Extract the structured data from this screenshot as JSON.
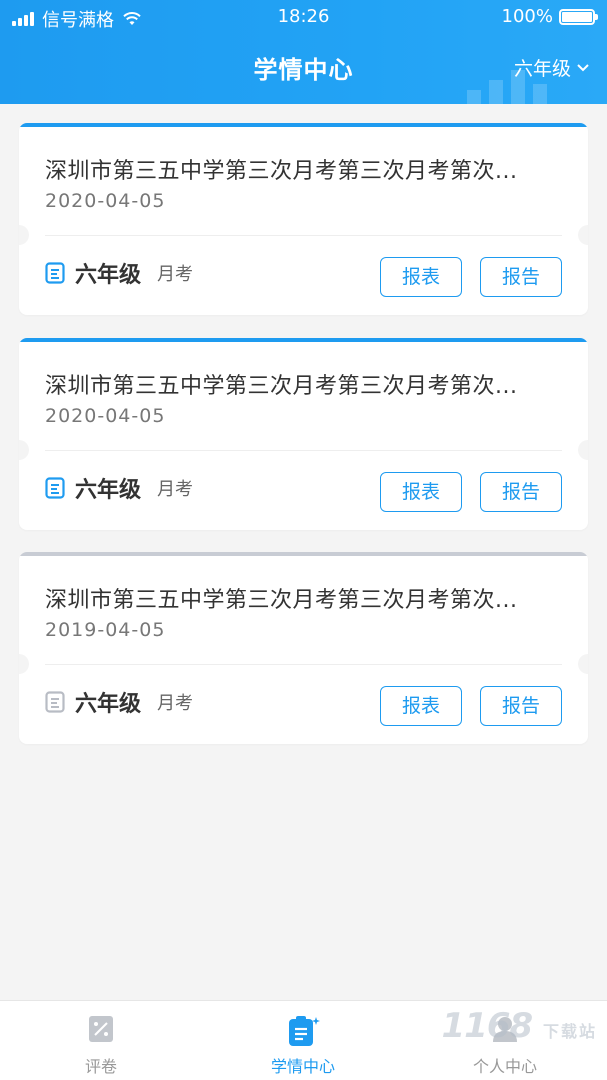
{
  "status_bar": {
    "carrier": "信号满格",
    "time": "18:26",
    "battery": "100%"
  },
  "header": {
    "title": "学情中心",
    "grade_selector": "六年级"
  },
  "cards": [
    {
      "title": "深圳市第三五中学第三次月考第三次月考第次...",
      "date": "2020-04-05",
      "grade": "六年级",
      "exam_type": "月考",
      "button_table": "报表",
      "button_report": "报告",
      "state": "active"
    },
    {
      "title": "深圳市第三五中学第三次月考第三次月考第次...",
      "date": "2020-04-05",
      "grade": "六年级",
      "exam_type": "月考",
      "button_table": "报表",
      "button_report": "报告",
      "state": "active"
    },
    {
      "title": "深圳市第三五中学第三次月考第三次月考第次...",
      "date": "2019-04-05",
      "grade": "六年级",
      "exam_type": "月考",
      "button_table": "报表",
      "button_report": "报告",
      "state": "inactive"
    }
  ],
  "tabbar": {
    "tabs": [
      {
        "label": "评卷",
        "icon": "grading-icon",
        "active": false
      },
      {
        "label": "学情中心",
        "icon": "clipboard-icon",
        "active": true
      },
      {
        "label": "个人中心",
        "icon": "person-icon",
        "active": false
      }
    ]
  },
  "watermark": {
    "text": "1168",
    "sub": "下载站"
  },
  "colors": {
    "accent": "#1e9bf0",
    "inactive": "#c8ccd4"
  }
}
